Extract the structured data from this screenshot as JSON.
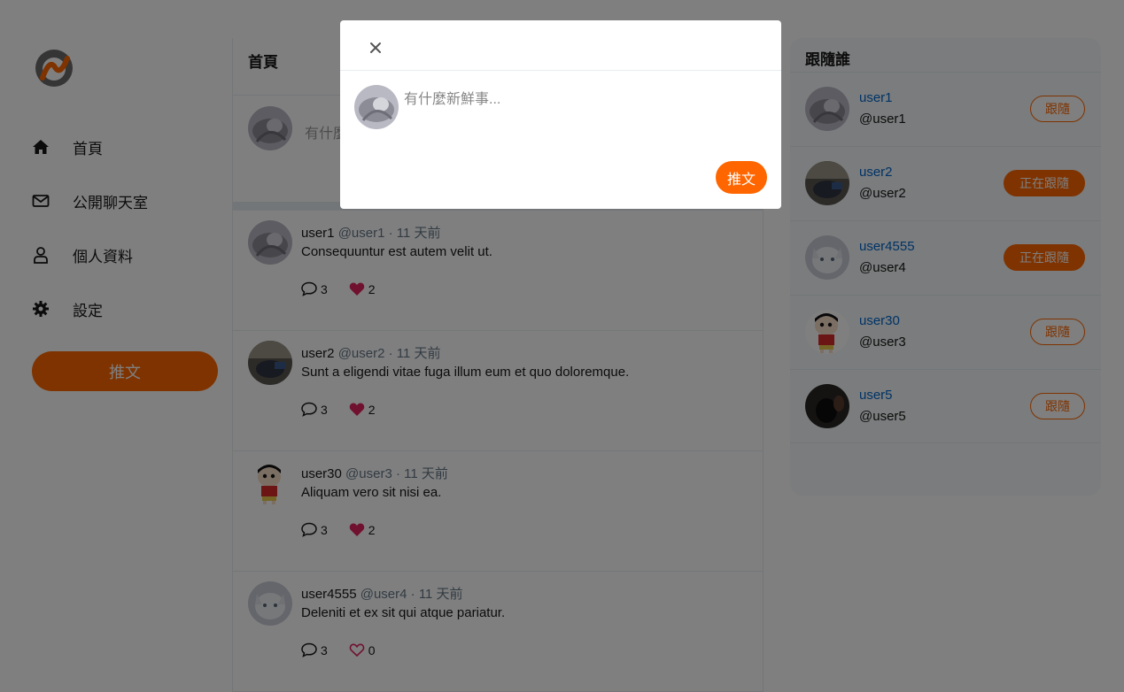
{
  "colors": {
    "brand": "#ff6600",
    "link": "#0066cc",
    "like": "#e0245e"
  },
  "sidebar": {
    "logo": "alphacamp-logo",
    "items": [
      {
        "label": "首頁",
        "icon": "home-icon"
      },
      {
        "label": "公開聊天室",
        "icon": "envelope-icon"
      },
      {
        "label": "個人資料",
        "icon": "user-icon"
      },
      {
        "label": "設定",
        "icon": "gear-icon"
      }
    ],
    "tweet_button": "推文"
  },
  "main": {
    "title": "首頁",
    "compose_placeholder": "有什麼新鮮事..."
  },
  "tweets": [
    {
      "name": "user1",
      "meta": "@user1 · 11 天前",
      "body": "Consequuntur est autem velit ut.",
      "replies": "3",
      "likes": "2",
      "liked": true
    },
    {
      "name": "user2",
      "meta": "@user2 · 11 天前",
      "body": "Sunt a eligendi vitae fuga illum eum et quo doloremque.",
      "replies": "3",
      "likes": "2",
      "liked": true
    },
    {
      "name": "user30",
      "meta": "@user3 · 11 天前",
      "body": "Aliquam vero sit nisi ea.",
      "replies": "3",
      "likes": "2",
      "liked": true
    },
    {
      "name": "user4555",
      "meta": "@user4 · 11 天前",
      "body": "Deleniti et ex sit qui atque pariatur.",
      "replies": "3",
      "likes": "0",
      "liked": false
    }
  ],
  "follow": {
    "title": "跟隨誰",
    "users": [
      {
        "name": "user1",
        "handle": "@user1",
        "button": "跟隨",
        "following": false
      },
      {
        "name": "user2",
        "handle": "@user2",
        "button": "正在跟隨",
        "following": true
      },
      {
        "name": "user4555",
        "handle": "@user4",
        "button": "正在跟隨",
        "following": true
      },
      {
        "name": "user30",
        "handle": "@user3",
        "button": "跟隨",
        "following": false
      },
      {
        "name": "user5",
        "handle": "@user5",
        "button": "跟隨",
        "following": false
      }
    ]
  },
  "modal": {
    "close_icon": "close-icon",
    "placeholder": "有什麼新鮮事...",
    "submit_label": "推文"
  }
}
